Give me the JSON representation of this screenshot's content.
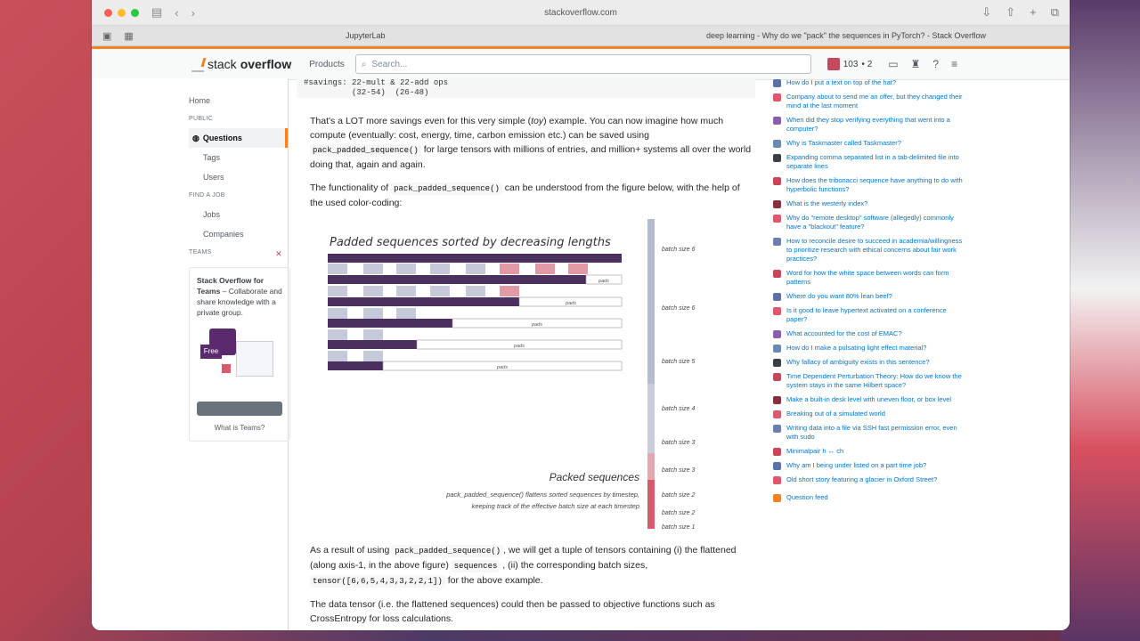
{
  "browser": {
    "url": "stackoverflow.com",
    "tabs": [
      "JupyterLab",
      "deep learning - Why do we \"pack\" the sequences in PyTorch? - Stack Overflow"
    ]
  },
  "header": {
    "logo_a": "stack",
    "logo_b": "overflow",
    "products": "Products",
    "search_placeholder": "Search...",
    "reputation": "103",
    "badges": "• 2"
  },
  "sidebar": {
    "home": "Home",
    "public_label": "PUBLIC",
    "questions": "Questions",
    "tags": "Tags",
    "users": "Users",
    "jobs_label": "FIND A JOB",
    "jobs": "Jobs",
    "companies": "Companies",
    "teams_label": "TEAMS",
    "teams_title": "Stack Overflow for Teams",
    "teams_text": " – Collaborate and share knowledge with a private group.",
    "free_badge": "Free",
    "teams_link": "What is Teams?"
  },
  "answer": {
    "code_top_1": "#savings: 22-mult & 22-add ops",
    "code_top_2": "          (32-54)  (26-48)",
    "p1_a": "That's a LOT more savings even for this very simple (",
    "p1_toy": "toy",
    "p1_b": ") example. You can now imagine how much compute (eventually: cost, energy, time, carbon emission etc.) can be saved using ",
    "p1_code": "pack_padded_sequence()",
    "p1_c": " for large tensors with millions of entries, and million+ systems all over the world doing that, again and again.",
    "p2_a": "The functionality of ",
    "p2_code": "pack_padded_sequence()",
    "p2_b": " can be understood from the figure below, with the help of the used color-coding:",
    "p3_a": "As a result of using ",
    "p3_code": "pack_padded_sequence()",
    "p3_b": ", we will get a tuple of tensors containing (i) the flattened (along axis-1, in the above figure) ",
    "p3_code2": "sequences",
    "p3_c": " , (ii) the corresponding batch sizes, ",
    "p3_code3": "tensor([6,6,5,4,3,3,2,2,1])",
    "p3_d": " for the above example.",
    "p4": "The data tensor (i.e. the flattened sequences) could then be passed to objective functions such as CrossEntropy for loss calculations."
  },
  "figure": {
    "title": "Padded sequences sorted by decreasing lengths",
    "pads": "pads",
    "packed_title": "Packed sequences",
    "packed_desc_1": "pack_padded_sequence() flattens sorted sequences by timestep,",
    "packed_desc_2": "keeping track of the effective batch size at each timestep",
    "batch_labels": [
      "batch size 6",
      "batch size 6",
      "batch size 5",
      "batch size 4",
      "batch size 3",
      "batch size 3",
      "batch size 2",
      "batch size 2",
      "batch size 1"
    ]
  },
  "hot_questions": [
    "How do I put a text on top of the hat?",
    "Company about to send me an offer, but they changed their mind at the last moment",
    "When did they stop verifying everything that went into a computer?",
    "Why is Taskmaster called Taskmaster?",
    "Expanding comma separated list in a tab-delimited file into separate lines",
    "How does the tribonacci sequence have anything to do with hyperbolic functions?",
    "What is the westerly index?",
    "Why do \"remote desktop\" software (allegedly) commonly have a \"blackout\" feature?",
    "How to reconcile desire to succeed in academia/willingness to prioritize research with ethical concerns about fair work practices?",
    "Word for how the white space between words can form patterns",
    "Where do you want 80% lean beef?",
    "Is it good to leave hypertext activated on a conference paper?",
    "What accounted for the cost of EMAC?",
    "How do I make a pulsating light effect material?",
    "Why fallacy of ambiguity exists in this sentence?",
    "Time Dependent Perturbation Theory: How do we know the system stays in the same Hilbert space?",
    "Make a built-in desk level with uneven floor, or box level",
    "Breaking out of a simulated world",
    "Writing data into a file via SSH fast permission error, even with sudo",
    "Minimalpair h ↔ ch",
    "Why am I being under listed on a part time job?",
    "Old short story featuring a glacier in Oxford Street?"
  ],
  "question_feed": "Question feed",
  "colors": {
    "accent": "#f48225",
    "bar_dark": "#4b2f5e",
    "bar_light": "#c5c9d9",
    "red": "#d85a6c"
  }
}
